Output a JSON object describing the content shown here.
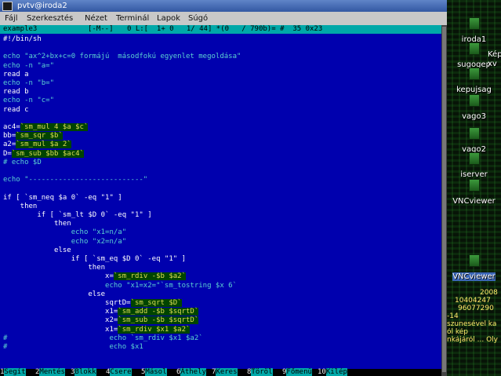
{
  "window": {
    "title": "pvtv@iroda2",
    "menu": [
      "Fájl",
      "Szerkesztés",
      "Nézet",
      "Terminál",
      "Lapok",
      "Súgó"
    ]
  },
  "editor": {
    "status": {
      "filename": "example3",
      "mode": "[-M--]",
      "position": "0 L:[  1+ 0   1/ 44] *(0   / 790b)= #  35 0x23"
    },
    "lines": [
      "#!/bin/sh",
      "",
      "echo \"ax^2+bx+c=0 formájú  másodfokú egyenlet megoldása\"",
      "echo -n \"a=\"",
      "read a",
      "echo -n \"b=\"",
      "read b",
      "echo -n \"c=\"",
      "read c",
      "",
      "ac4=`sm_mul 4 $a $c`",
      "bb=`sm_sqr $b`",
      "a2=`sm_mul $a 2`",
      "D=`sm_sub $bb $ac4`",
      "# echo $D",
      "",
      "echo \"---------------------------\"",
      "",
      "if [ `sm_neq $a 0` -eq \"1\" ]",
      "    then",
      "        if [ `sm_lt $D 0` -eq \"1\" ]",
      "            then",
      "                echo \"x1=n/a\"",
      "                echo \"x2=n/a\"",
      "            else",
      "                if [ `sm_eq $D 0` -eq \"1\" ]",
      "                    then",
      "                        x=`sm_rdiv -$b $a2`",
      "                        echo \"x1=x2=\"`sm_tostring $x 6`",
      "                    else",
      "                        sqrtD=`sm_sqrt $D`",
      "                        x1=`sm_add -$b $sqrtD`",
      "                        x2=`sm_sub -$b $sqrtD`",
      "                        x1=`sm_rdiv $x1 $a2`",
      "#                        echo `sm_rdiv $x1 $a2`",
      "#                        echo $x1"
    ],
    "line_types": [
      "cmd",
      "blank",
      "cmt",
      "cmt",
      "cmd",
      "cmt",
      "cmd",
      "cmt",
      "cmd",
      "blank",
      "var",
      "var",
      "var",
      "var",
      "cmt",
      "blank",
      "cmt",
      "blank",
      "cmd",
      "cmd",
      "cmd",
      "cmd",
      "cmt",
      "cmt",
      "cmd",
      "cmd",
      "cmd",
      "var",
      "cmt",
      "cmd",
      "var",
      "var",
      "var",
      "var",
      "cmt",
      "cmt"
    ],
    "function_keys": [
      {
        "num": "1",
        "label": "Segít"
      },
      {
        "num": "2",
        "label": "Mentés"
      },
      {
        "num": "3",
        "label": "Blokk"
      },
      {
        "num": "4",
        "label": "Csere"
      },
      {
        "num": "5",
        "label": "Másol"
      },
      {
        "num": "6",
        "label": "Áthely"
      },
      {
        "num": "7",
        "label": "Keres"
      },
      {
        "num": "8",
        "label": "Töröl"
      },
      {
        "num": "9",
        "label": "Főmenü"
      },
      {
        "num": "10",
        "label": "Kilép"
      }
    ]
  },
  "desktop": {
    "icons": [
      "iroda1",
      "sugogep",
      "kepujsag",
      "vago3",
      "vago2",
      "iserver",
      "VNCviewer",
      "VNCviewer"
    ],
    "side_labels": [
      "Kép",
      "xv"
    ],
    "misc": [
      "2008",
      "10404247",
      "96077290",
      "-14",
      "szunesével ka",
      "",
      "ól kép",
      "nkájáról ... Oly"
    ]
  },
  "colors": {
    "terminal_bg": "#0000ae",
    "status_bg": "#00a8a8",
    "titlebar": "#3358a2"
  }
}
